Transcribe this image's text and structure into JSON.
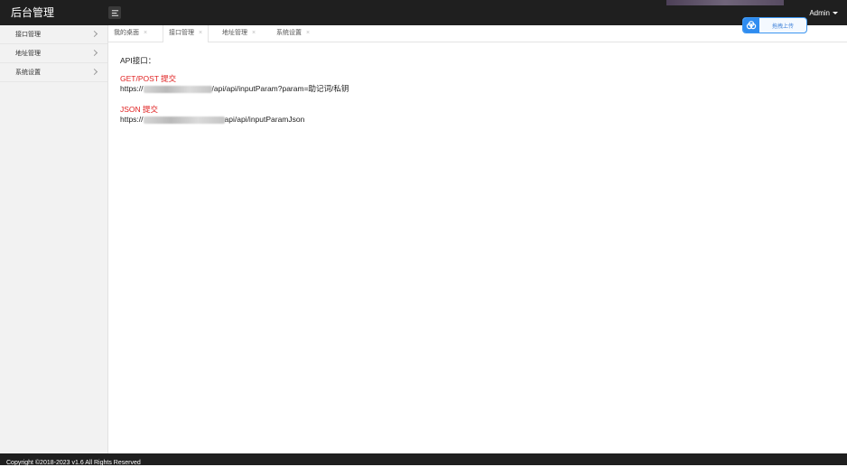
{
  "header": {
    "brand": "后台管理",
    "user": "Admin"
  },
  "sidebar": {
    "items": [
      {
        "label": "接口管理"
      },
      {
        "label": "地址管理"
      },
      {
        "label": "系统设置"
      }
    ]
  },
  "tabs": [
    {
      "label": "我的桌面",
      "close": "×"
    },
    {
      "label": "接口管理",
      "close": "×",
      "active": true
    },
    {
      "label": "地址管理",
      "close": "×"
    },
    {
      "label": "系统设置",
      "close": "×"
    }
  ],
  "upload_widget": {
    "label": "拖拽上传"
  },
  "content": {
    "heading": "API接口：",
    "get_post": {
      "method": "GET/POST 提交",
      "url_prefix": "https://",
      "url_suffix": "/api/api/inputParam?param=助记词/私钥"
    },
    "json": {
      "method": "JSON 提交",
      "url_prefix": "https://",
      "url_suffix": "api/api/inputParamJson"
    }
  },
  "footer": {
    "copyright": "Copyright ©2018-2023 v1.6 All Rights Reserved"
  },
  "colors": {
    "topbar": "#1f1f1f",
    "sidebar": "#f2f2f2",
    "method_red": "#e02020",
    "upload_blue": "#2f8cf0"
  }
}
